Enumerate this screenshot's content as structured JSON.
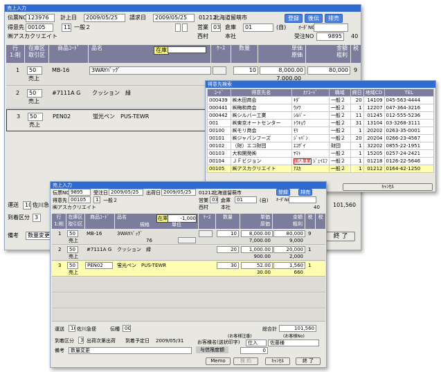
{
  "w1": {
    "title": "売上入力",
    "slip_no_label": "伝票NO",
    "slip_no": "123976",
    "acc_date_label": "計上日",
    "acc_date": "2009/05/25",
    "bill_date_label": "請求日",
    "bill_date": "2009/05/25",
    "area_code": "01212",
    "area_name": "北海道留萌市",
    "btn_reg": "登録",
    "btn_next": "後伝",
    "btn_del": "排売",
    "cust_label": "得意先",
    "cust_code": "00105",
    "rank_code": "11",
    "rank_name": "一般２",
    "office_label": "営業",
    "office_code": "03",
    "wh_label": "倉庫",
    "wh_code": "01",
    "wh_name": "(自)",
    "order_label": "ｵｰﾀﾞNO",
    "cust_name": "㈱アスカクリエイト",
    "staff": "西村",
    "branch": "本社",
    "recv_label": "受注NO",
    "recv_no": "9895",
    "recv_page": "40",
    "head": {
      "line": "行",
      "line2": "1:削",
      "wh": "在庫区",
      "wh2": "取引区",
      "item_code": "商品ｺｰﾄﾞ",
      "item_name": "品名",
      "stock": "在庫",
      "case": "ｹｰｽ",
      "qty": "数量",
      "price": "単価",
      "cost": "原価",
      "amount": "金額",
      "profit": "粗利",
      "tax": "税"
    },
    "rows": [
      {
        "no": "1",
        "wh": "50",
        "type": "売上",
        "code": "MB-16",
        "name": "3WAYﾊﾞｯｸﾞ",
        "qty": "10",
        "price": "8,000.00",
        "cost": "7,000.00",
        "amount": "80,000",
        "tax": "9"
      },
      {
        "no": "2",
        "wh": "50",
        "type": "売上",
        "code": "#7111A G",
        "name": "クッション　緑"
      },
      {
        "no": "3",
        "wh": "50",
        "type": "売上",
        "code": "PEN02",
        "name": "蛍光ペン　PUS-TEWR"
      }
    ],
    "ship_label": "運送",
    "ship_code": "10",
    "ship_name": "佐川急",
    "dest_label": "到着区分",
    "dest_code": "3",
    "memo_label": "備考",
    "memo": "数量変更",
    "total": "101,560",
    "btn_end": "終 了"
  },
  "w2": {
    "title": "得意先検索",
    "cols": [
      "ｺｰﾄﾞ",
      "得意先名",
      "ｶﾅｺｰﾄﾞ",
      "職域",
      "締日",
      "地域CD",
      "TEL"
    ],
    "rows": [
      [
        "000439",
        "㈱木田商会",
        "ｷﾀﾞ",
        "一般２",
        "20",
        "14109",
        "045-563-4444"
      ],
      [
        "000441",
        "㈱梅和商会",
        "ｳﾒﾜ",
        "一般２",
        "1",
        "12207",
        "047-364-3216"
      ],
      [
        "000442",
        "㈱シルバー工業",
        "ｼﾙﾊﾞｰ",
        "一般２",
        "11",
        "01245",
        "012-555-5236"
      ],
      [
        "001",
        "㈱東京オートセンター",
        "ﾄｳｷｮｳ",
        "一般２",
        "31",
        "13104",
        "03-3268-3111"
      ],
      [
        "00100",
        "㈱モリ商会",
        "ﾓﾘ",
        "一般２",
        "1",
        "20202",
        "0263-35-0001"
      ],
      [
        "00101",
        "㈱ジャパンフーズ",
        "ｼﾞｬﾊﾟﾝ",
        "一般２",
        "20",
        "20204",
        "0266-23-4567"
      ],
      [
        "00102",
        "（財）エコ財団",
        "ｴｺｻﾞｲ",
        "財団",
        "1",
        "32202",
        "0855-22-1951"
      ],
      [
        "00103",
        "大和開発㈱",
        "ﾔﾏﾄ",
        "一般２",
        "1",
        "15205",
        "0257-24-2421"
      ],
      [
        "00104",
        "ＪＦビジョン",
        "ｼﾞｪｲｴﾌ",
        "一般２",
        "1",
        "01218",
        "0126-22-5646"
      ],
      [
        "00105",
        "㈱アスカクリエイト",
        "ｱｽｶ",
        "一般２",
        "1",
        "01212",
        "0164-42-1250"
      ]
    ],
    "tag": "個人事業",
    "cancel": "ｷｬﾝｾﾙ"
  },
  "w3": {
    "title": "売上入力",
    "slip_no_label": "伝票NO",
    "slip_no": "9895",
    "recv_date_label": "受注日",
    "recv_date": "2009/05/25",
    "ship_date_label": "出荷日",
    "ship_date": "2009/05/25",
    "area_code": "01212",
    "area_name": "北海道留萌市",
    "btn_reg": "登録",
    "btn_del": "排売",
    "cust_label": "得意先",
    "cust_code": "00105",
    "rank_code": "11",
    "rank_name": "一般２",
    "office_label": "営業",
    "office_code": "03",
    "wh_label": "倉庫",
    "wh_code": "01",
    "wh_name": "(自)",
    "order_label": "ｵｰﾀﾞNO",
    "cust_name": "㈱アスカクリエイト",
    "staff": "西村",
    "branch": "本社",
    "recv_page": "40",
    "head": {
      "line": "行",
      "line2": "1:削",
      "wh": "在庫区",
      "wh2": "取引区",
      "code": "商品ｺｰﾄﾞ",
      "name": "品名",
      "spec": "規格",
      "unit": "単位",
      "stock": "在庫",
      "stock_val": "-1,000",
      "case": "ｹｰｽ",
      "qty": "数量",
      "price": "単価",
      "cost": "原価",
      "amount": "金額",
      "profit": "粗利",
      "tax": "税",
      "tax2": "税"
    },
    "rows": [
      {
        "no": "1",
        "wh": "50",
        "type": "売上",
        "code": "MB-16",
        "name": "3WAYﾊﾞｯｸﾞ",
        "spec": "76",
        "qty": "10",
        "price": "8,000.00",
        "cost": "7,000.00",
        "amount": "80,000",
        "profit": "9,000",
        "tax": "9"
      },
      {
        "no": "2",
        "wh": "50",
        "type": "売上",
        "code": "#7111A G",
        "name": "クッション　緑",
        "qty": "20",
        "price": "1,000.00",
        "cost": "900.00",
        "amount": "20,000",
        "profit": "2,000",
        "tax": "1"
      },
      {
        "no": "3",
        "wh": "50",
        "type": "売上",
        "code": "PEN02",
        "name": "蛍光ペン　PUS-TEWR",
        "qty": "30",
        "price": "52.00",
        "cost": "30.00",
        "amount": "1,560",
        "profit": "660",
        "tax": "1"
      }
    ],
    "ship_label": "運送",
    "ship_code": "10",
    "ship_name": "佐川急便",
    "slip_label": "伝種",
    "slip_code": "00",
    "total_label": "総合計",
    "total": "101,560",
    "dest_label": "到着区分",
    "dest_code": "3",
    "dest_name": "出荷次第出荷",
    "arrive_label": "到着予定日",
    "arrive_date": "2009/05/31",
    "cust_ref_label": "お客様名(送状印字)",
    "cust_ref_note": "(お客様注番)",
    "cust_ref_val": "仕入",
    "cust_no_label": "(お客様No)",
    "cust_no_val": "佐藤様",
    "memo_label": "備考",
    "memo": "数量変更",
    "limit_label": "与信限度額",
    "limit_val": "0",
    "btn_memo": "Memo",
    "btn_check": "検 約",
    "btn_cancel": "ｷｬﾝｾﾙ",
    "btn_end": "終 了"
  }
}
